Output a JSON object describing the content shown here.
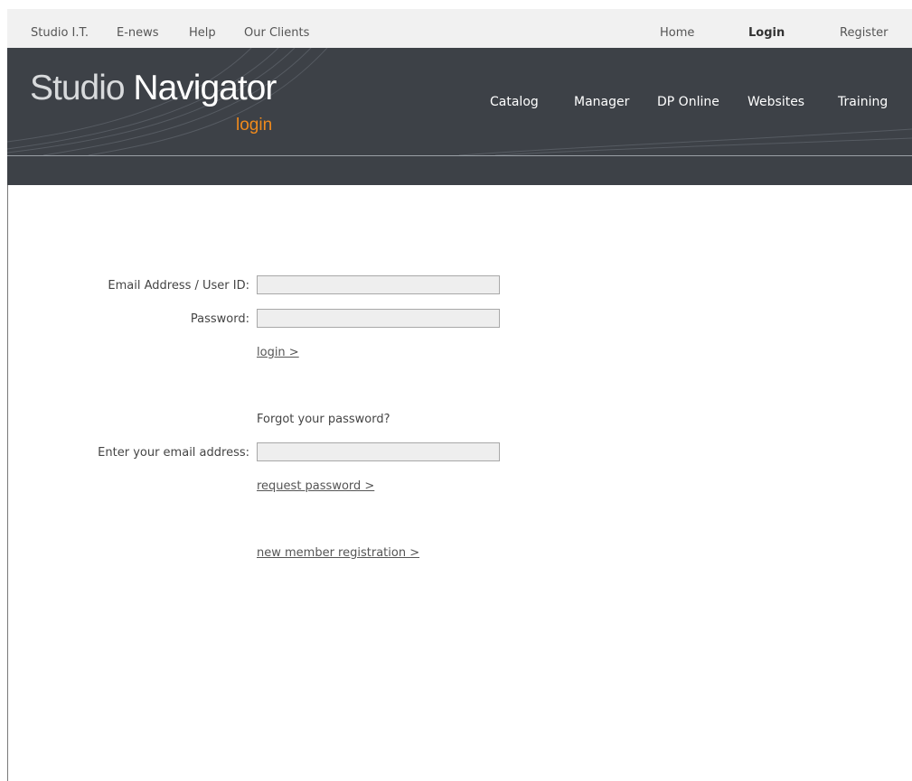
{
  "top_links": {
    "studio_it": "Studio I.T.",
    "enews": "E-news",
    "help": "Help",
    "our_clients": "Our Clients",
    "home": "Home",
    "login": "Login",
    "register": "Register"
  },
  "brand": {
    "name_part1": "Studio ",
    "name_part2": "Navigator",
    "section": "login",
    "accent_color": "#f08a1c",
    "header_color": "#3d4147"
  },
  "main_nav": {
    "catalog": "Catalog",
    "manager": "Manager",
    "dp_online": "DP Online",
    "websites": "Websites",
    "training": "Training"
  },
  "login_form": {
    "email_label": "Email Address / User ID:",
    "email_value": "",
    "password_label": "Password:",
    "password_value": "",
    "login_link": "login >"
  },
  "forgot_form": {
    "heading": "Forgot your password?",
    "email_label": "Enter your email address:",
    "email_value": "",
    "request_link": "request password >"
  },
  "register_link": "new member registration >"
}
